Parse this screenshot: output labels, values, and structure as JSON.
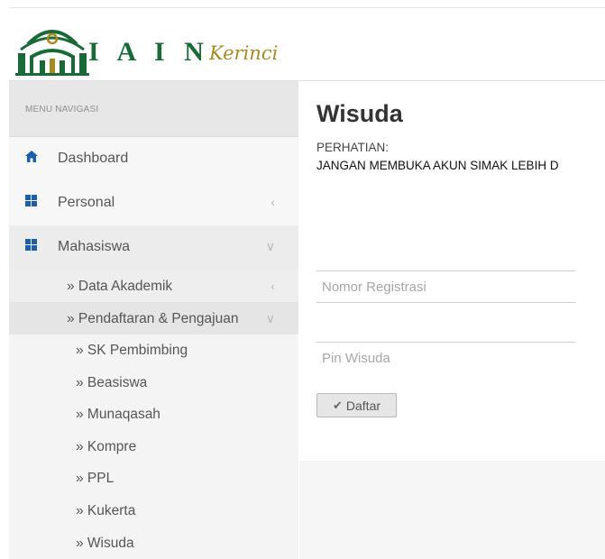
{
  "brand": {
    "name": "I A I N",
    "script": "Kerinci"
  },
  "menu_header": "MENU NAVIGASI",
  "menu": {
    "dashboard": "Dashboard",
    "personal": "Personal",
    "mahasiswa": "Mahasiswa",
    "data_akademik": "» Data Akademik",
    "pendaftaran": "» Pendaftaran & Pengajuan",
    "sub": [
      "» SK Pembimbing",
      "» Beasiswa",
      "» Munaqasah",
      "» Kompre",
      "» PPL",
      "» Kukerta",
      "» Wisuda"
    ]
  },
  "page": {
    "title": "Wisuda",
    "notice_heading": "PERHATIAN:",
    "notice_text": "JANGAN MEMBUKA AKUN SIMAK LEBIH D"
  },
  "form": {
    "registration_placeholder": "Nomor Registrasi",
    "pin_placeholder": "Pin Wisuda",
    "submit_label": "Daftar"
  },
  "icons": {
    "dashboard": "home-icon",
    "personal": "grid-icon",
    "mahasiswa": "grid-icon",
    "submit": "check-icon",
    "collapsed": "chevron-left-icon",
    "expanded": "chevron-down-icon"
  },
  "colors": {
    "accent": "#1c5fa8",
    "brand_green": "#1a6a38",
    "brand_gold": "#a88a1e"
  }
}
